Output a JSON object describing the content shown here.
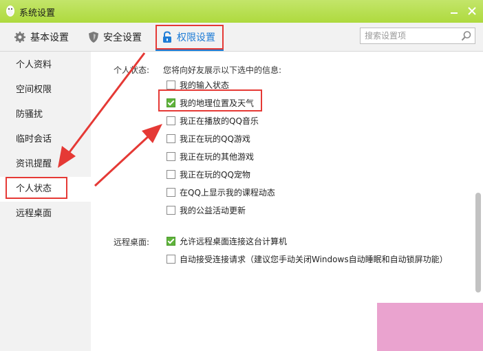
{
  "window": {
    "title": "系统设置"
  },
  "toolbar": {
    "tabs": [
      {
        "label": "基本设置",
        "icon": "gear-icon"
      },
      {
        "label": "安全设置",
        "icon": "shield-icon"
      },
      {
        "label": "权限设置",
        "icon": "lock-icon",
        "active": true
      }
    ],
    "search_placeholder": "搜索设置项"
  },
  "sidebar": {
    "items": [
      {
        "label": "个人资料"
      },
      {
        "label": "空间权限"
      },
      {
        "label": "防骚扰"
      },
      {
        "label": "临时会话"
      },
      {
        "label": "资讯提醒"
      },
      {
        "label": "个人状态",
        "active": true
      },
      {
        "label": "远程桌面"
      }
    ]
  },
  "personal_status": {
    "label": "个人状态:",
    "description": "您将向好友展示以下选中的信息:",
    "options": [
      {
        "label": "我的输入状态",
        "checked": false
      },
      {
        "label": "我的地理位置及天气",
        "checked": true
      },
      {
        "label": "我正在播放的QQ音乐",
        "checked": false
      },
      {
        "label": "我正在玩的QQ游戏",
        "checked": false
      },
      {
        "label": "我正在玩的其他游戏",
        "checked": false
      },
      {
        "label": "我正在玩的QQ宠物",
        "checked": false
      },
      {
        "label": "在QQ上显示我的课程动态",
        "checked": false
      },
      {
        "label": "我的公益活动更新",
        "checked": false
      }
    ]
  },
  "remote_desktop": {
    "label": "远程桌面:",
    "options": [
      {
        "label": "允许远程桌面连接这台计算机",
        "checked": true
      },
      {
        "label": "自动接受连接请求（建议您手动关闭Windows自动睡眠和自动锁屏功能）",
        "checked": false
      }
    ]
  },
  "colors": {
    "titlebar": "#b5de4a",
    "accent": "#1e7cd6",
    "checkbox_checked": "#5fb33b",
    "highlight": "#e53935",
    "pink": "#eaa3cf"
  }
}
